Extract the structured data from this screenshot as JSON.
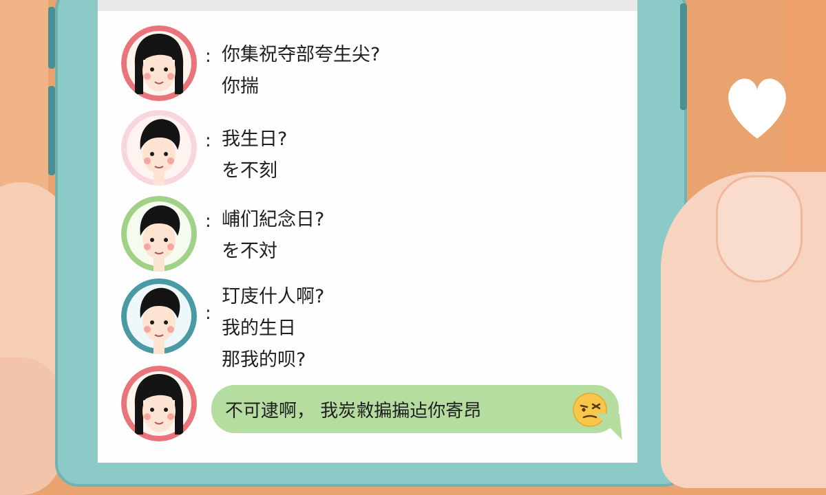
{
  "messages": [
    {
      "avatar": "woman-avatar",
      "lines": [
        "你集祝夺部夸生尖?",
        "你揣"
      ]
    },
    {
      "avatar": "man-avatar-pink",
      "lines": [
        "我生日?",
        "を不刻"
      ]
    },
    {
      "avatar": "man-avatar-green",
      "lines": [
        "峬们紀念日?",
        "を不対"
      ]
    },
    {
      "avatar": "man-avatar-teal",
      "lines": [
        "玎庋什人啊?",
        "我的生日",
        "那我的呗?"
      ]
    }
  ],
  "reply": {
    "avatar": "woman-avatar",
    "text": "不可逮啊， 我炭敹揙揙迠你寄昂",
    "emoji": "annoyed-face-emoji"
  },
  "colon": ":",
  "colors": {
    "background": "#e9a36f",
    "phone": "#8ccac8",
    "bubble": "#b6dda0",
    "avatar_ring_red": "#e9747c",
    "avatar_ring_pink": "#f8d6dd",
    "avatar_ring_green": "#9fd186",
    "avatar_ring_teal": "#4a9aa5"
  },
  "decor": {
    "heart": "heart-icon"
  }
}
